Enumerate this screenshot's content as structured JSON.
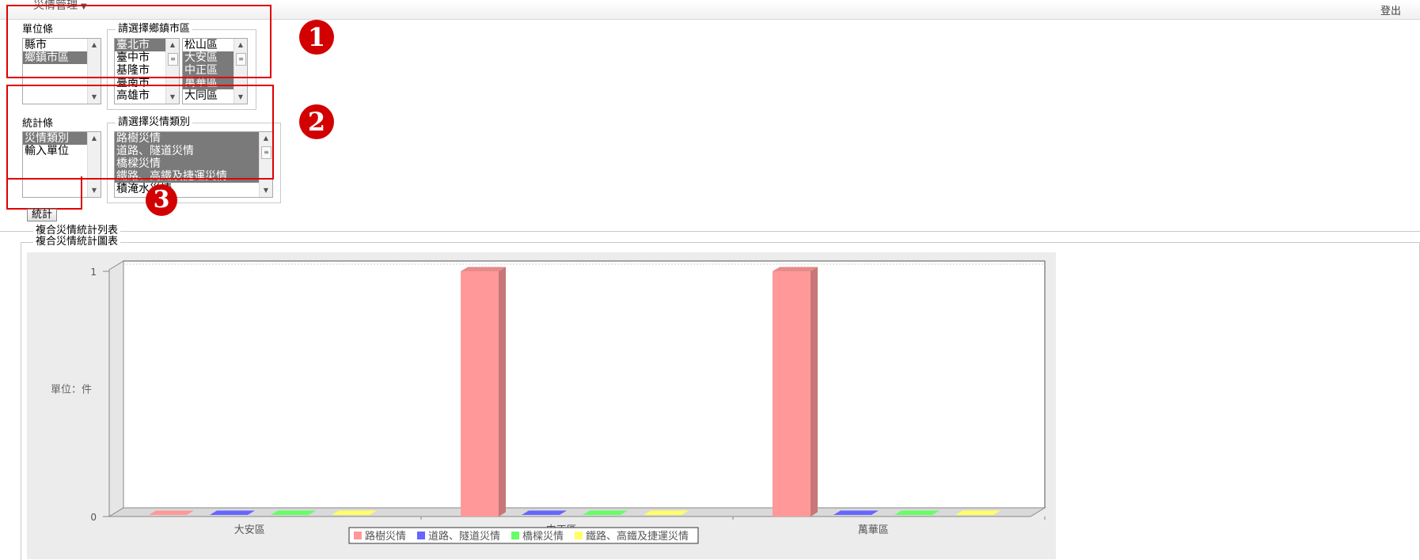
{
  "topbar": {
    "menu_title": "災情管理",
    "caret": "▼",
    "logout": "登出"
  },
  "unit_section": {
    "label": "單位條",
    "list": [
      "縣市",
      "鄉鎮市區"
    ],
    "selected_index": 1,
    "fieldset_legend": "請選擇鄉鎮市區",
    "cities": [
      "臺北市",
      "臺中市",
      "基隆市",
      "臺南市",
      "高雄市"
    ],
    "cities_selected": [
      0
    ],
    "districts": [
      "松山區",
      "大安區",
      "中正區",
      "萬華區",
      "大同區"
    ],
    "districts_selected": [
      1,
      2,
      3
    ]
  },
  "stat_section": {
    "label": "統計條",
    "list": [
      "災情類別",
      "輸入單位"
    ],
    "selected_index": 0,
    "fieldset_legend": "請選擇災情類別",
    "categories": [
      "路樹災情",
      "道路、隧道災情",
      "橋樑災情",
      "鐵路、高鐵及捷運災情",
      "積淹水災情"
    ],
    "categories_selected": [
      0,
      1,
      2,
      3
    ]
  },
  "badges": [
    "1",
    "2",
    "3"
  ],
  "stat_button": "統計",
  "sections": {
    "list_title": "複合災情統計列表",
    "chart_title": "複合災情統計圖表"
  },
  "icons": {
    "scroll_up": "up-arrow-icon",
    "scroll_down": "down-arrow-icon",
    "thumb": "grip-icon"
  },
  "chart_data": {
    "type": "bar",
    "categories": [
      "大安區",
      "中正區",
      "萬華區"
    ],
    "series": [
      {
        "name": "路樹災情",
        "values": [
          0,
          1,
          1
        ],
        "color": "#ff9999"
      },
      {
        "name": "道路、隧道災情",
        "values": [
          0,
          0,
          0
        ],
        "color": "#6666ff"
      },
      {
        "name": "橋樑災情",
        "values": [
          0,
          0,
          0
        ],
        "color": "#66ff66"
      },
      {
        "name": "鐵路、高鐵及捷運災情",
        "values": [
          0,
          0,
          0
        ],
        "color": "#ffff66"
      }
    ],
    "ylabel": "單位：件",
    "yticks": [
      "0",
      "1"
    ],
    "ylim": [
      0,
      1
    ],
    "legend_position": "bottom",
    "style": "3d"
  }
}
